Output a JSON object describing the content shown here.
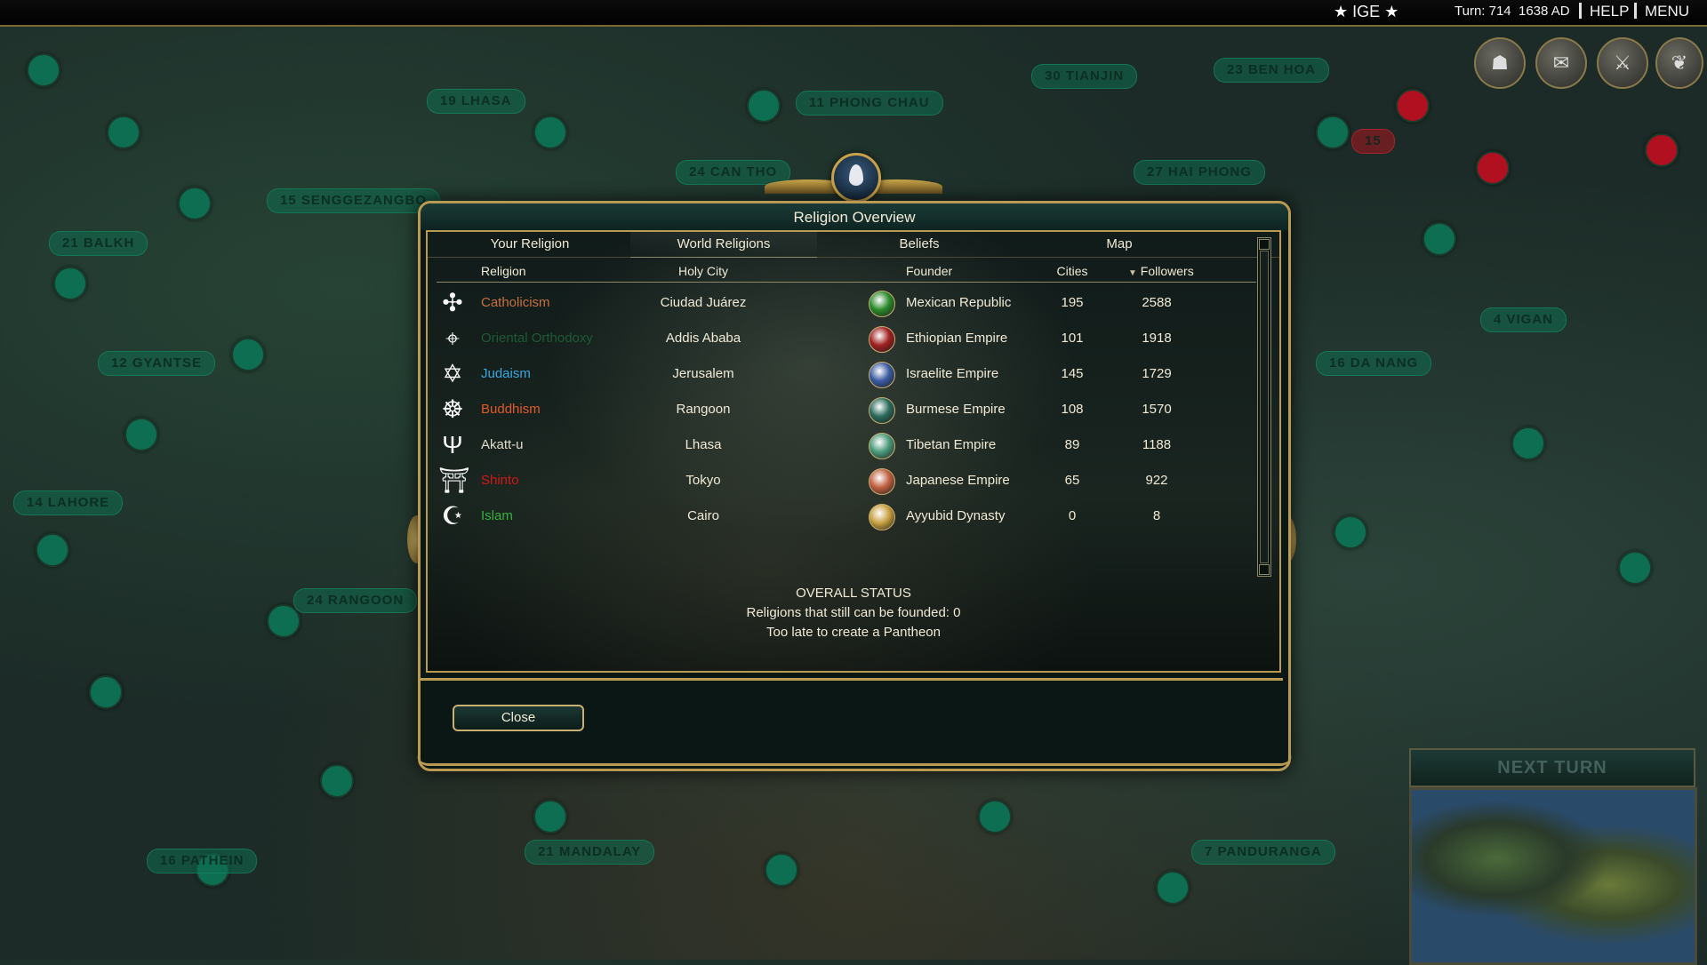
{
  "top_bar": {
    "ige": "IGE",
    "turn": "Turn: 714",
    "year": "1638 AD",
    "help": "HELP",
    "menu": "MENU"
  },
  "map_cities": [
    {
      "label": "19 LHASA",
      "color": "green"
    },
    {
      "label": "11 PHONG CHAU",
      "color": "green"
    },
    {
      "label": "30 TIANJIN",
      "color": "green"
    },
    {
      "label": "23 BEN HOA",
      "color": "green"
    },
    {
      "label": "15 SENGGEZANGBO",
      "color": "green"
    },
    {
      "label": "24 CAN THO",
      "color": "green"
    },
    {
      "label": "27 HAI PHONG",
      "color": "green"
    },
    {
      "label": "21 BALKH",
      "color": "green"
    },
    {
      "label": "12 GYANTSE",
      "color": "green"
    },
    {
      "label": "4 VIGAN",
      "color": "green"
    },
    {
      "label": "16 DA NANG",
      "color": "green"
    },
    {
      "label": "14 LAHORE",
      "color": "green"
    },
    {
      "label": "24 RANGOON",
      "color": "green"
    },
    {
      "label": "21 MANDALAY",
      "color": "green"
    },
    {
      "label": "16 PATHEIN",
      "color": "green"
    },
    {
      "label": "7 PANDURANGA",
      "color": "green"
    },
    {
      "label": "15",
      "color": "red"
    }
  ],
  "next_turn": "NEXT TURN",
  "dialog": {
    "title": "Religion Overview",
    "tabs": [
      "Your Religion",
      "World Religions",
      "Beliefs",
      "Map"
    ],
    "active_tab": "World Religions",
    "columns": {
      "religion": "Religion",
      "holy_city": "Holy City",
      "founder": "Founder",
      "cities": "Cities",
      "followers": "Followers"
    },
    "sort_indicator": "▼",
    "rows": [
      {
        "icon": "cross-icon",
        "glyph": "✣",
        "religion": "Catholicism",
        "color": "#c8703c",
        "holy_city": "Ciudad Juárez",
        "founder": "Mexican Republic",
        "civ_color": "#2a8a2a",
        "cities": "195",
        "followers": "2588"
      },
      {
        "icon": "orthodox-icon",
        "glyph": "⌖",
        "religion": "Oriental Orthodoxy",
        "color": "#1e5a34",
        "holy_city": "Addis Ababa",
        "founder": "Ethiopian Empire",
        "civ_color": "#a02020",
        "cities": "101",
        "followers": "1918"
      },
      {
        "icon": "star-of-david-icon",
        "glyph": "✡",
        "religion": "Judaism",
        "color": "#3aa8e0",
        "holy_city": "Jerusalem",
        "founder": "Israelite Empire",
        "civ_color": "#3a5aa0",
        "cities": "145",
        "followers": "1729"
      },
      {
        "icon": "dharma-wheel-icon",
        "glyph": "☸",
        "religion": "Buddhism",
        "color": "#e05a28",
        "holy_city": "Rangoon",
        "founder": "Burmese Empire",
        "civ_color": "#2a6a5a",
        "cities": "108",
        "followers": "1570"
      },
      {
        "icon": "trident-icon",
        "glyph": "Ψ",
        "religion": "Akatt-u",
        "color": "#e0dcc8",
        "holy_city": "Lhasa",
        "founder": "Tibetan Empire",
        "civ_color": "#4a9a7a",
        "cities": "89",
        "followers": "1188"
      },
      {
        "icon": "torii-icon",
        "glyph": "⛩",
        "religion": "Shinto",
        "color": "#d01818",
        "holy_city": "Tokyo",
        "founder": "Japanese Empire",
        "civ_color": "#c06040",
        "cities": "65",
        "followers": "922"
      },
      {
        "icon": "crescent-icon",
        "glyph": "☪",
        "religion": "Islam",
        "color": "#3ab040",
        "holy_city": "Cairo",
        "founder": "Ayyubid Dynasty",
        "civ_color": "#c8a040",
        "cities": "0",
        "followers": "8"
      }
    ],
    "status_title": "OVERALL STATUS",
    "status_line1": "Religions that still can be founded: 0",
    "status_line2": "Too late to create a Pantheon",
    "close_label": "Close"
  },
  "colors": {
    "frame_gold": "#b89a52",
    "panel_bg": "#0a1715",
    "title_bar": "#1a3a36"
  }
}
